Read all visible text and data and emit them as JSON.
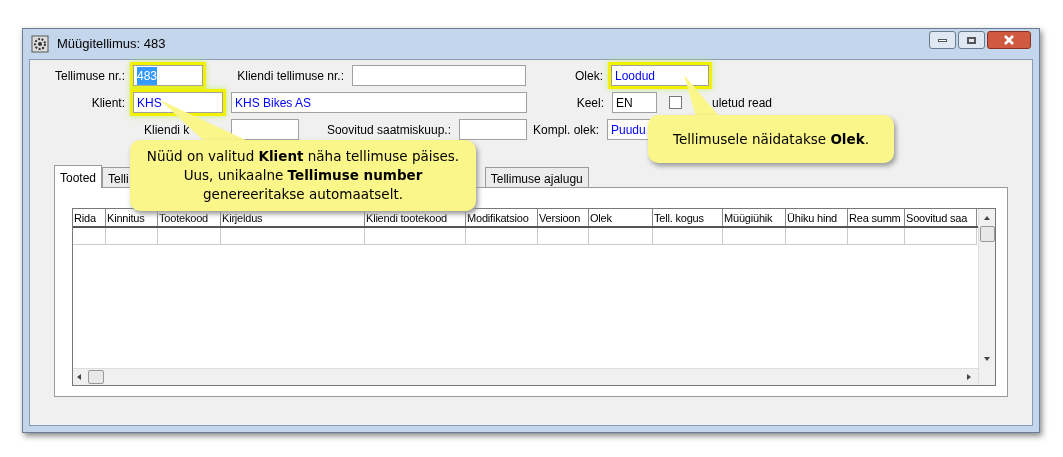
{
  "window": {
    "title": "Müügitellimus: 483"
  },
  "fields": [
    {
      "label": "Tellimuse nr.:",
      "value": "483",
      "text_selected": true,
      "highlighted": true
    },
    {
      "label": "Kliendi tellimuse nr.:",
      "highlighted": false
    },
    {
      "label": "Olek:",
      "value": "Loodud",
      "text_selected": false,
      "highlighted": true,
      "color": "#0000ff"
    },
    {
      "label": "Klient:",
      "value": "KHS",
      "text_selected": false,
      "highlighted": true,
      "color": "#0000ff"
    },
    {
      "value": "KHS Bikes AS",
      "text_selected": false,
      "highlighted": false,
      "color": "#0000ff"
    },
    {
      "label": "Keel:",
      "value": "EN",
      "text_selected": false,
      "highlighted": false,
      "color": "#000000"
    },
    {
      "label": "Kliendi k",
      "highlighted": false
    },
    {
      "label": "Soovitud saatmiskuup.:",
      "highlighted": false
    },
    {
      "label": "Kompl. olek:",
      "value": "Puudu",
      "text_selected": false,
      "highlighted": false,
      "color": "#0000ff"
    }
  ],
  "checkbox": {
    "label": "uletud read",
    "checked": false
  },
  "tabs": [
    {
      "label": "Tooted",
      "selected": true
    },
    {
      "label": "Telli",
      "selected": false
    },
    {
      "label": "Tellimuse ajalugu",
      "selected": false
    }
  ],
  "table": {
    "columns": [
      "Rida",
      "Kinnitus",
      "Tootekood",
      "Kirjeldus",
      "Kliendi tootekood",
      "Modifikatsioo",
      "Versioon",
      "Olek",
      "Tell. kogus",
      "Müügiühik",
      "Ühiku hind",
      "Rea summ",
      "Soovitud saa"
    ]
  },
  "callouts": [
    {
      "text": "Nüüd on valitud **Klient** näha tellimuse päises.  Uus, unikaalne **Tellimuse number** genereeritakse automaatselt."
    },
    {
      "text": "Tellimusele näidatakse **Olek**."
    }
  ]
}
